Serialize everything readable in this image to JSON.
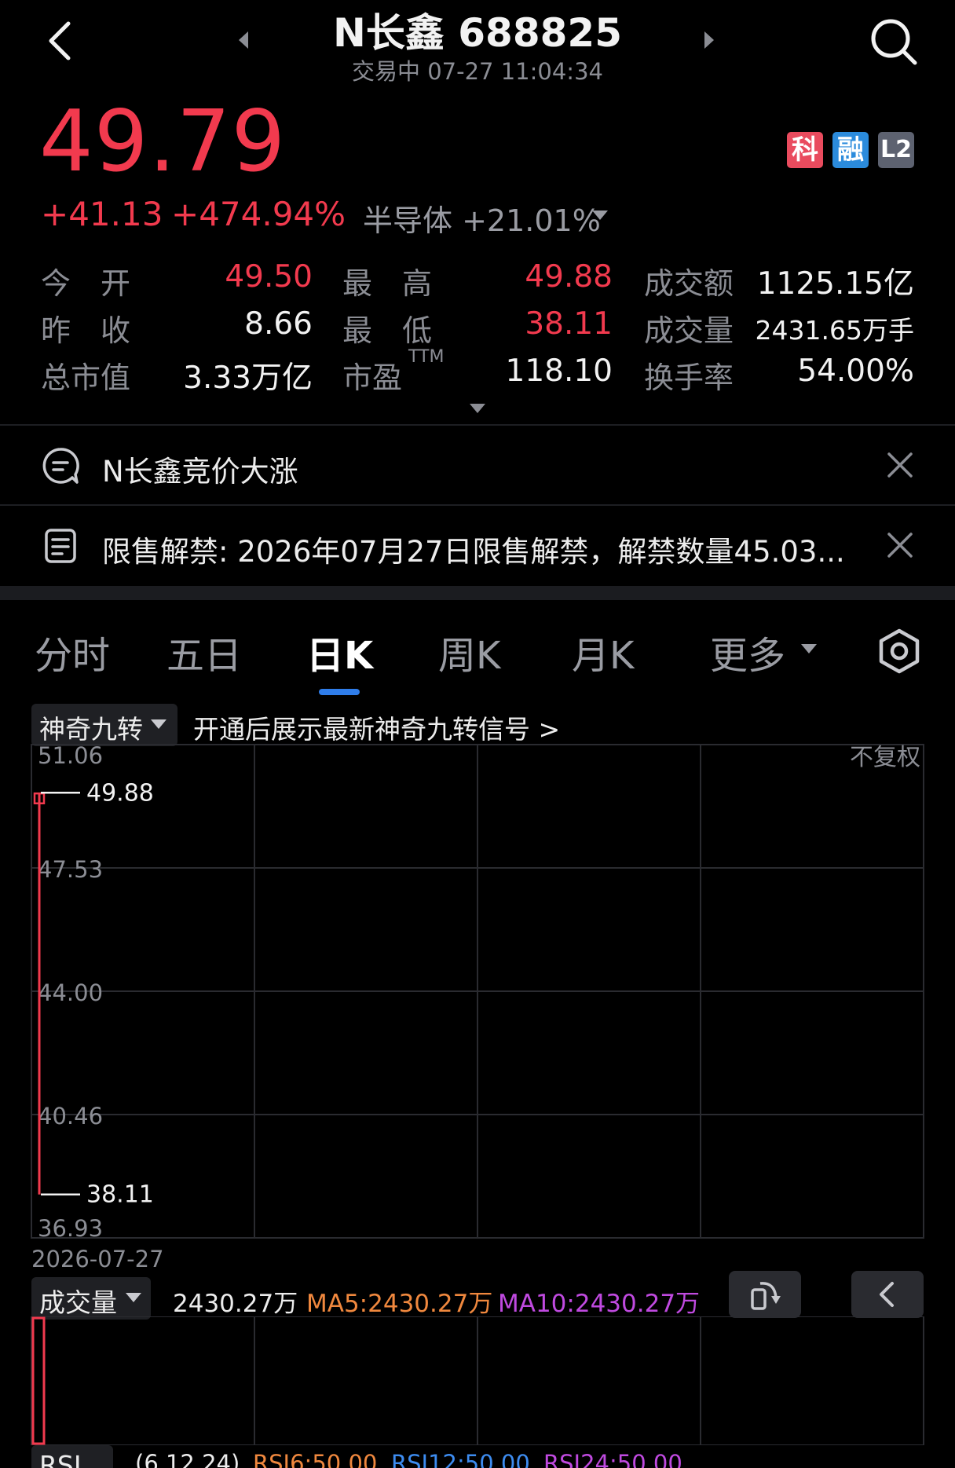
{
  "header": {
    "title": "N长鑫 688825",
    "subtitle": "交易中 07-27 11:04:34"
  },
  "quote": {
    "price": "49.79",
    "change": "+41.13",
    "change_pct": "+474.94%",
    "sector": "半导体 +21.01%",
    "badges": [
      "科",
      "融",
      "L2"
    ]
  },
  "stats": {
    "row1": {
      "l1": "今　开",
      "v1": "49.50",
      "l2": "最　高",
      "v2": "49.88",
      "l3": "成交额",
      "v3": "1125.15亿"
    },
    "row2": {
      "l1": "昨　收",
      "v1": "8.66",
      "l2": "最　低",
      "v2": "38.11",
      "l3": "成交量",
      "v3": "2431.65万手"
    },
    "row3": {
      "l1": "总市值",
      "v1": "3.33万亿",
      "l2": "市盈",
      "l2sup": "TTM",
      "v2": "118.10",
      "l3": "换手率",
      "v3": "54.00%"
    }
  },
  "news": [
    {
      "text": "N长鑫竞价大涨"
    },
    {
      "text": "限售解禁: 2026年07月27日限售解禁，解禁数量45.03..."
    }
  ],
  "tabs": [
    "分时",
    "五日",
    "日K",
    "周K",
    "月K",
    "更多"
  ],
  "indicator": {
    "name": "神奇九转",
    "promo": "开通后展示最新神奇九转信号 >"
  },
  "chart_data": {
    "type": "candlestick",
    "price_axis": [
      "51.06",
      "47.53",
      "44.00",
      "40.46",
      "36.93"
    ],
    "adjust_label": "不复权",
    "high_label": "49.88",
    "low_label": "38.11",
    "date_label": "2026-07-27",
    "candles": [
      {
        "date": "2026-07-27",
        "open": 49.5,
        "high": 49.88,
        "low": 38.11,
        "close": 49.79
      }
    ],
    "ylim": [
      36.93,
      51.06
    ]
  },
  "volume": {
    "name": "成交量",
    "value": "2430.27万",
    "ma5": "MA5:2430.27万",
    "ma10": "MA10:2430.27万",
    "ma5_color": "#f0883e",
    "ma10_color": "#c04ae0"
  },
  "rsi": {
    "name": "RSI",
    "params": "(6,12,24)",
    "rsi6": "RSI6:50.00",
    "rsi12": "RSI12:50.00",
    "rsi24": "RSI24:50.00"
  },
  "colors": {
    "up": "#f23a4e",
    "accent": "#2f7dea"
  }
}
